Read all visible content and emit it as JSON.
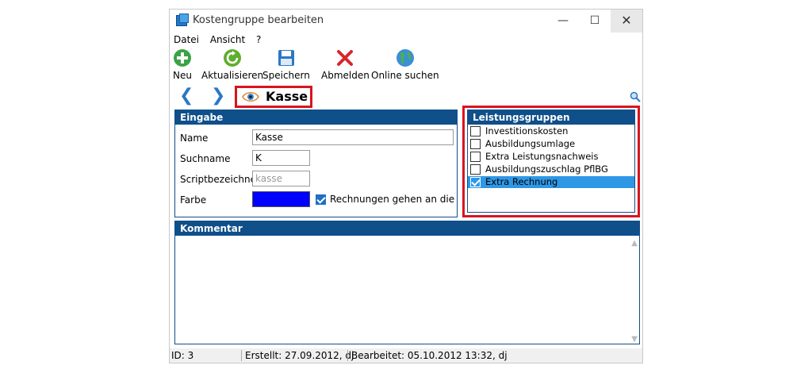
{
  "window": {
    "title": "Kostengruppe bearbeiten",
    "controls": {
      "minimize": "—",
      "maximize": "☐",
      "close": "✕"
    }
  },
  "menu": [
    "Datei",
    "Ansicht",
    "?"
  ],
  "toolbar": {
    "neu": "Neu",
    "aktualisieren": "Aktualisieren",
    "speichern": "Speichern",
    "abmelden": "Abmelden",
    "online_suchen": "Online suchen"
  },
  "nav": {
    "back": "❮",
    "forward": "❯",
    "record_name": "Kasse"
  },
  "eingabe": {
    "title": "Eingabe",
    "name_label": "Name",
    "name_value": "Kasse",
    "suchname_label": "Suchname",
    "suchname_value": "K",
    "script_label": "Scriptbezeichner",
    "script_placeholder": "kasse",
    "farbe_label": "Farbe",
    "farbe_color": "#0000ff",
    "rechnungen_checked": true,
    "rechnungen_label": "Rechnungen gehen an die Kasse"
  },
  "leistungsgruppen": {
    "title": "Leistungsgruppen",
    "items": [
      {
        "label": "Investitionskosten",
        "checked": false,
        "selected": false
      },
      {
        "label": "Ausbildungsumlage",
        "checked": false,
        "selected": false
      },
      {
        "label": "Extra Leistungsnachweis",
        "checked": false,
        "selected": false
      },
      {
        "label": "Ausbildungszuschlag PflBG",
        "checked": false,
        "selected": false
      },
      {
        "label": "Extra Rechnung",
        "checked": true,
        "selected": true
      }
    ]
  },
  "kommentar": {
    "title": "Kommentar",
    "value": ""
  },
  "status": {
    "id": "ID: 3",
    "erstellt": "Erstellt: 27.09.2012, dj",
    "bearbeitet": "Bearbeitet: 05.10.2012 13:32, dj"
  },
  "colors": {
    "panel_header": "#0f4f8a",
    "highlight_border": "#d8141e",
    "selection": "#2e97e6"
  }
}
